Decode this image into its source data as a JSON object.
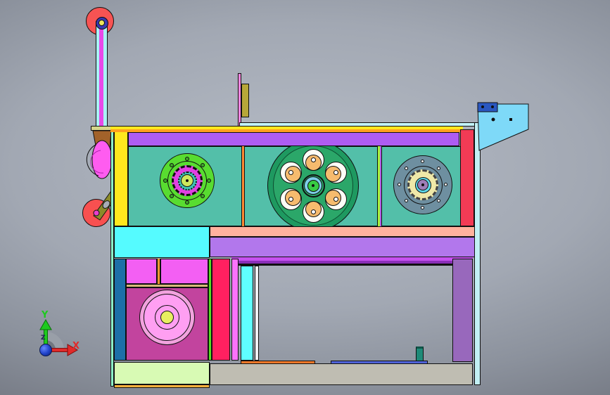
{
  "viewport": {
    "type": "cad-3d-assembly-view",
    "background_top": "#8b919c",
    "background_center": "#b5bbc5",
    "background_bottom": "#5e616a"
  },
  "triad": {
    "x_label": "X",
    "y_label": "Y",
    "z_label": "Z",
    "x_color": "#e02a2a",
    "y_color": "#1ec91e",
    "origin_sphere_color": "#2244cc",
    "arc_color": "#999fa8"
  },
  "parts": {
    "pulley_wheel": "#f75353",
    "pulley_hub_ring": "#3838b0",
    "pulley_hub_center": "#eee65a",
    "pulley_rod": "#a9f2f4",
    "pulley_rod_core": "#e84ae8",
    "rod_mount_bar": "#d6d68c",
    "mount_cone": "#a2622a",
    "pink_linkage": "#ff5cf0",
    "crank_arm": "#8a8a28",
    "lower_roller": "#f85050",
    "roller_pin": "#e83ecc",
    "frame_left_sliver": "#8defc8",
    "frame_left_column": "#ffe81e",
    "frame_top_strip": "#c2f2f8",
    "frame_top_orange_rail": "#ffa01e",
    "frame_top_band": "#ae5cf2",
    "main_panel": "#53bfa9",
    "panel_divider_orange": "#ff8833",
    "panel_divider_green": "#a8f23c",
    "frame_right_band": "#f23b55",
    "frame_right_face": "#c2f0f5",
    "tab_strip": "#ff85e0",
    "tab_block": "#b7a738",
    "left_flange": "#58dc30",
    "left_flange_ring": "#e23fe2",
    "left_flange_bearing": "#3fc4b4",
    "left_flange_center": "#cce85c",
    "center_wheel_rim": "#1e9960",
    "center_wheel_face": "#2ba769",
    "cam_follower": "#f6bb6e",
    "wheel_hub_ring": "#7ccfe8",
    "wheel_hub_center": "#38cc44",
    "right_flange": "#6e8fa0",
    "right_flange_gear": "#efe9a8",
    "right_flange_ring": "#5cd8e8",
    "right_flange_center": "#9e7eb8",
    "cyan_block": "#55fbff",
    "salmon_rail": "#ffb29e",
    "purple_rail": "#b277ec",
    "left_leg": "#1d6fa8",
    "magenta_panel": "#f35ff3",
    "dial_housing": "#c2449e",
    "dial_ring": "#f2a2de",
    "dial_face": "#ff9ff2",
    "dial_center": "#e8ef60",
    "crimson_leg": "#ff2060",
    "pink_leg_strip": "#fc72fc",
    "cyan_leg": "#5fffff",
    "right_leg": "#9868bc",
    "left_base_block": "#d8fab4",
    "base_plate": "#bfbdb2",
    "floor_rail_orange": "#f07828",
    "floor_rail_blue": "#4f62d8",
    "floor_cylinder": "#1e8a78",
    "corner_bracket": "#7ed9f8",
    "bracket_clamp": "#2a57c0"
  }
}
